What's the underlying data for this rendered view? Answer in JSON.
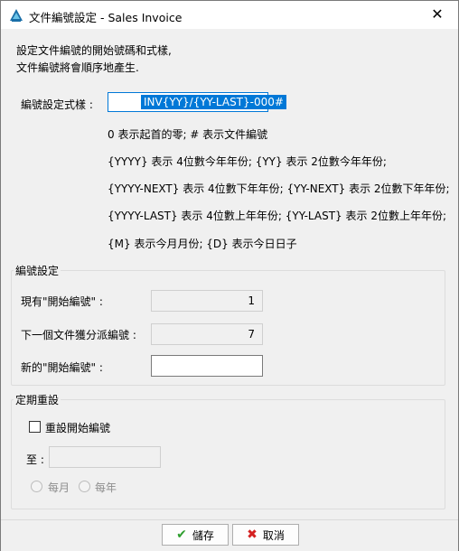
{
  "window": {
    "title": "文件編號設定 - Sales Invoice"
  },
  "intro": {
    "line1": "設定文件編號的開始號碼和式樣,",
    "line2": "文件編號將會順序地產生."
  },
  "format": {
    "label": "編號設定式樣 :",
    "value": "INV{YY}/{YY-LAST}-000#"
  },
  "help": [
    "0 表示起首的零; # 表示文件編號",
    "{YYYY} 表示 4位數今年年份; {YY} 表示 2位數今年年份;",
    "{YYYY-NEXT} 表示 4位數下年年份;  {YY-NEXT} 表示 2位數下年年份;",
    "{YYYY-LAST} 表示 4位數上年年份;  {YY-LAST} 表示 2位數上年年份;",
    "{M} 表示今月月份; {D} 表示今日日子"
  ],
  "numbering": {
    "legend": "編號設定",
    "current_label": "現有\"開始編號\" :",
    "current_value": "1",
    "next_label": "下一個文件獲分派編號 :",
    "next_value": "7",
    "new_label": "新的\"開始編號\" :",
    "new_value": ""
  },
  "reset": {
    "legend": "定期重設",
    "checkbox_label": "重設開始編號",
    "checked": false,
    "to_label": "至 :",
    "to_value": "",
    "monthly_label": "每月",
    "yearly_label": "每年"
  },
  "buttons": {
    "save_label": "儲存",
    "cancel_label": "取消"
  },
  "colors": {
    "accent": "#0078d7",
    "save_icon": "#2e9e2e",
    "cancel_icon": "#d42020"
  }
}
